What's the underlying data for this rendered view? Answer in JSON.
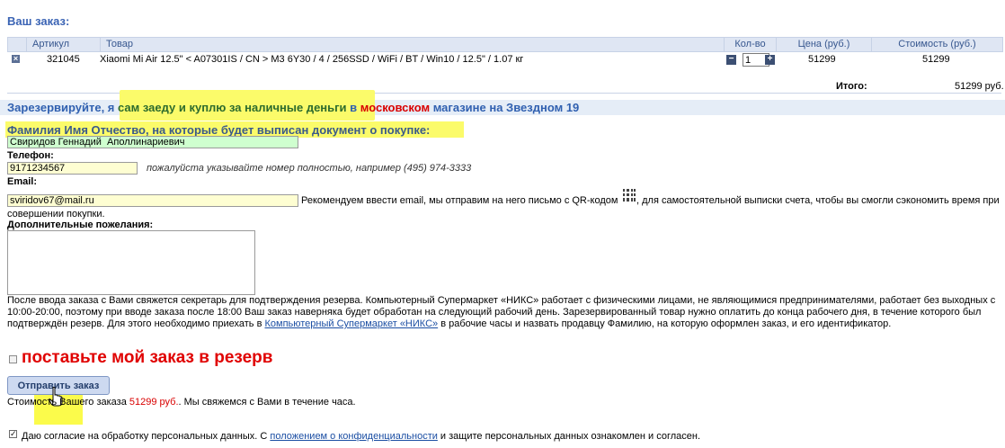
{
  "order": {
    "title": "Ваш заказ:",
    "columns": [
      "Артикул",
      "Товар",
      "Кол-во",
      "Цена (руб.)",
      "Стоимость (руб.)"
    ],
    "row": {
      "sku": "321045",
      "product": "Xiaomi Mi Air 12.5\" < A07301IS / CN > M3 6Y30 / 4 / 256SSD / WiFi / BT / Win10 / 12.5\" / 1.07 кг",
      "qty": "1",
      "price": "51299",
      "cost": "51299"
    },
    "total_label": "Итого:",
    "total_value": "51299 руб."
  },
  "banner": {
    "part1": "Зарезервируйте, я ",
    "highlight": "сам заеду и куплю за наличные деньги",
    "part2": " в ",
    "red": "московском",
    "part3": " магазине на Звездном 19"
  },
  "form": {
    "fio_label": "Фамилия Имя Отчество, на которые будет выписан документ о покупке:",
    "fio_value": "Свиридов Геннадий  Аполлинариевич",
    "phone_label": "Телефон:",
    "phone_value": "9171234567",
    "phone_hint": "пожалуйста указывайте номер полностью, например (495) 974-3333",
    "email_label": "Email:",
    "email_value": "sviridov67@mail.ru",
    "email_hint_a": "Рекомендуем ввести email, мы отправим на него письмо с QR-кодом",
    "email_hint_b": ", для самостоятельной выписки счета, чтобы вы смогли сэкономить время при",
    "email_hint_c": "совершении покупки.",
    "notes_label": "Дополнительные пожелания:"
  },
  "info": {
    "text1": "После ввода заказа с Вами свяжется секретарь для подтверждения резерва. Компьютерный Супермаркет «НИКС» работает с физическими лицами, не являющимися предпринимателями, работает без выходных с",
    "text2": "10:00-20:00, поэтому при вводе заказа после 18:00 Ваш заказ наверняка будет обработан на следующий рабочий день. Зарезервированный товар нужно оплатить до конца рабочего дня, в течение которого был",
    "text3a": "подтверждён резерв. Для этого необходимо приехать в ",
    "link": "Компьютерный Супермаркет «НИКС»",
    "text3b": " в рабочие часы и назвать продавцу Фамилию, на которую оформлен заказ, и его идентификатор."
  },
  "reserve": {
    "label": "поставьте мой заказ в резерв"
  },
  "submit": {
    "label": "Отправить заказ"
  },
  "price_note": {
    "prefix": "Стоимость Вашего заказа ",
    "amount": "51299 руб.",
    "suffix": ". Мы свяжемся с Вами в течение часа."
  },
  "consent": {
    "prefix": "Даю согласие на обработку персональных данных. С ",
    "link": "положением о конфиденциальности",
    "suffix": " и защите персональных данных ознакомлен и согласен."
  }
}
